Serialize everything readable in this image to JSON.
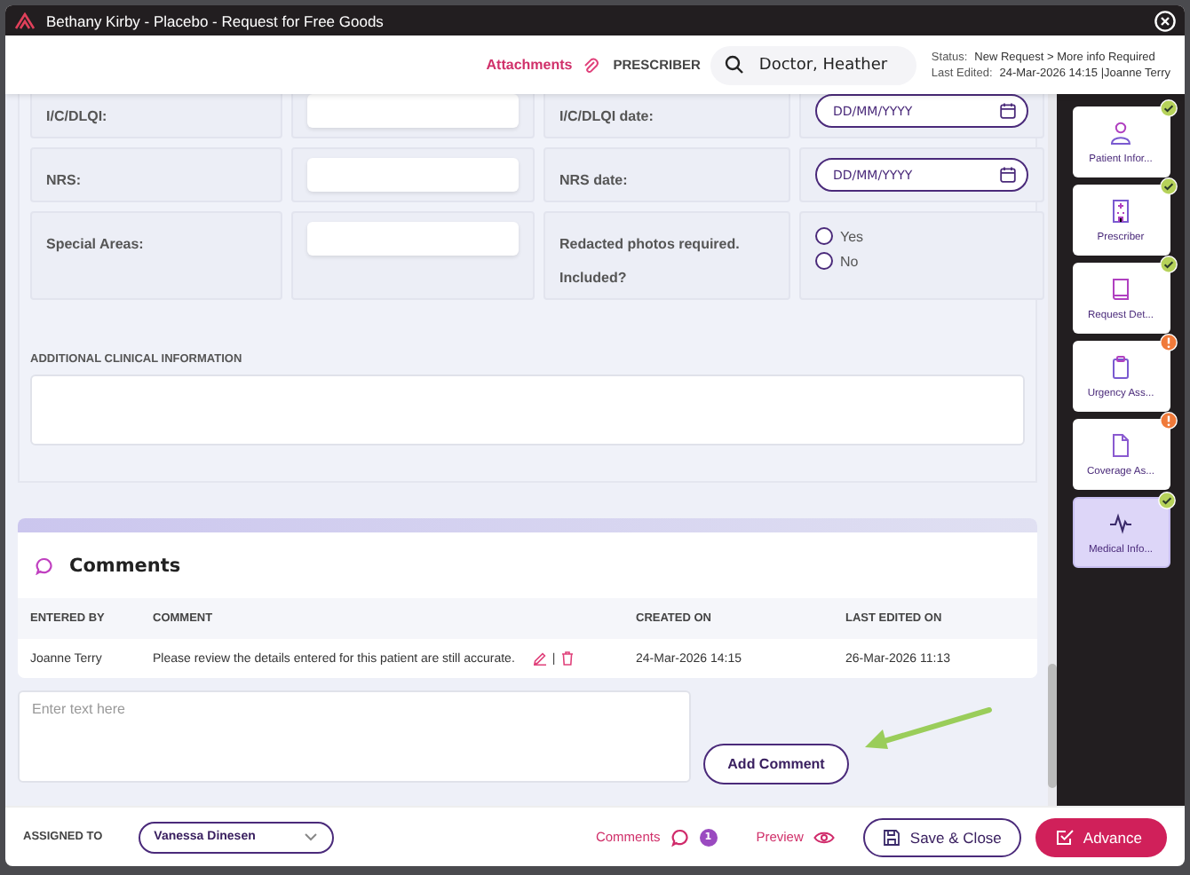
{
  "window": {
    "title": "Bethany Kirby - Placebo - Request for Free Goods"
  },
  "header": {
    "attachments": "Attachments",
    "prescriber_label": "PRESCRIBER",
    "prescriber_search": "Doctor, Heather",
    "status_label": "Status:",
    "status": "New Request > More info Required",
    "last_edited_label": "Last Edited:",
    "last_edited": "24-Mar-2026 14:15 |Joanne Terry"
  },
  "form": {
    "rows": [
      {
        "label": "I/C/DLQI:",
        "label_2": "I/C/DLQI date:",
        "kind": "date",
        "placeholder": "DD/MM/YYYY"
      },
      {
        "label": "NRS:",
        "label_2": "NRS date:",
        "kind": "date",
        "placeholder": "DD/MM/YYYY"
      },
      {
        "label": "Special Areas:",
        "label_2": "Redacted photos required. Included?",
        "kind": "radio",
        "options": [
          {
            "label": "Yes",
            "selected": false
          },
          {
            "label": "No",
            "selected": false
          }
        ]
      }
    ],
    "additional_label": "ADDITIONAL CLINICAL INFORMATION"
  },
  "comments": {
    "title": "Comments",
    "columns": [
      "ENTERED BY",
      "COMMENT",
      "CREATED ON",
      "LAST EDITED ON"
    ],
    "rows": [
      {
        "entered_by": "Joanne Terry",
        "comment": "Please review the details entered for this patient are still accurate.",
        "separator": "|",
        "created_on": "24-Mar-2026 14:15",
        "last_edited_on": "26-Mar-2026 11:13"
      }
    ],
    "placeholder": "Enter text here",
    "add_button": "Add Comment"
  },
  "sidebar": {
    "items": [
      {
        "label": "Patient Infor...",
        "kind": "person",
        "complete": true,
        "selected": false
      },
      {
        "label": "Prescriber",
        "kind": "building",
        "complete": true,
        "selected": false
      },
      {
        "label": "Request Det...",
        "kind": "book",
        "complete": true,
        "selected": false
      },
      {
        "label": "Urgency Ass...",
        "kind": "clipboard",
        "complete": false,
        "selected": false
      },
      {
        "label": "Coverage As...",
        "kind": "document",
        "complete": false,
        "selected": false
      },
      {
        "label": "Medical Info...",
        "kind": "pulse",
        "complete": true,
        "selected": true
      }
    ]
  },
  "footer": {
    "assigned_label": "ASSIGNED TO",
    "assignee": "Vanessa Dinesen",
    "comments_link": "Comments",
    "comments_count": "1",
    "preview_link": "Preview",
    "save_button": "Save & Close",
    "advance_button": "Advance"
  }
}
